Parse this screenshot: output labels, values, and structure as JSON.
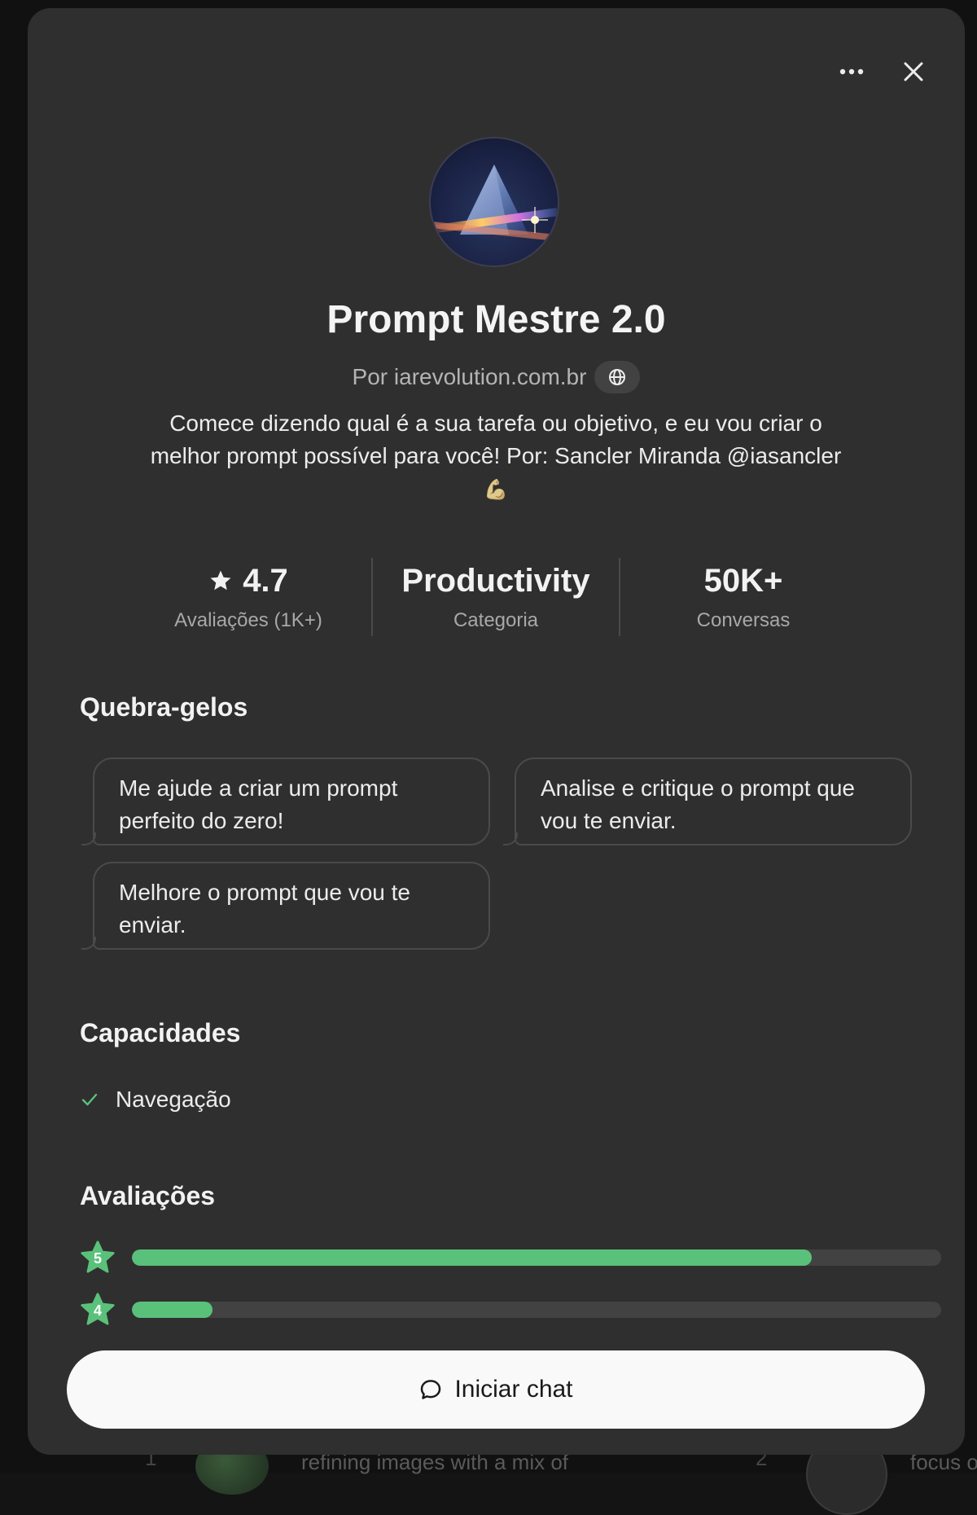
{
  "modal": {
    "title": "Prompt Mestre 2.0",
    "byline": "Por iarevolution.com.br",
    "description": "Comece dizendo qual é a sua tarefa ou objetivo, e eu vou criar o melhor prompt possível para você! Por: Sancler Miranda @iasancler",
    "description_emoji": "💪",
    "icons": {
      "more": "more-horizontal-icon",
      "close": "close-icon",
      "globe": "globe-icon",
      "star": "star-icon",
      "check": "check-icon",
      "chat": "chat-bubble-icon"
    }
  },
  "stats": {
    "rating": {
      "value": "4.7",
      "label": "Avaliações (1K+)"
    },
    "category": {
      "value": "Productivity",
      "label": "Categoria"
    },
    "conversations": {
      "value": "50K+",
      "label": "Conversas"
    }
  },
  "starters": {
    "title": "Quebra-gelos",
    "items": [
      "Me ajude a criar um prompt perfeito do zero!",
      "Analise e critique o prompt que vou te enviar.",
      "Melhore o prompt que vou te enviar."
    ]
  },
  "capabilities": {
    "title": "Capacidades",
    "items": [
      "Navegação"
    ]
  },
  "ratings": {
    "title": "Avaliações",
    "rows": [
      {
        "stars": "5",
        "fraction": 0.84
      },
      {
        "stars": "4",
        "fraction": 0.1
      }
    ]
  },
  "cta": {
    "label": "Iniciar chat"
  },
  "background": {
    "snippet": "refining images with a mix of",
    "snippet_right": "focus o",
    "rank_left": "1",
    "rank_right": "2"
  },
  "colors": {
    "accent_green": "#5ac17a",
    "modal_bg": "#2f2f2f",
    "cta_bg": "#f9f9f9"
  }
}
